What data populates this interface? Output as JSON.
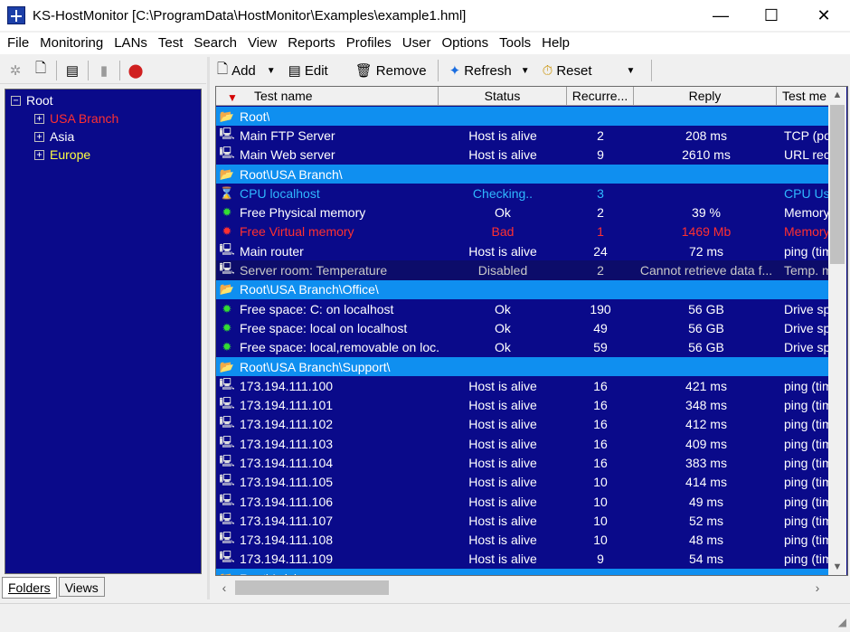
{
  "window": {
    "title": "KS-HostMonitor  [C:\\ProgramData\\HostMonitor\\Examples\\example1.hml]",
    "minimize": "—",
    "maximize": "☐",
    "close": "✕"
  },
  "menu": [
    "File",
    "Monitoring",
    "LANs",
    "Test",
    "Search",
    "View",
    "Reports",
    "Profiles",
    "User",
    "Options",
    "Tools",
    "Help"
  ],
  "tree": {
    "root": "Root",
    "children": [
      {
        "label": "USA Branch",
        "color": "#ff3030"
      },
      {
        "label": "Asia",
        "color": "#ffffff"
      },
      {
        "label": "Europe",
        "color": "#ffff40"
      }
    ]
  },
  "bottom_tabs": [
    "Folders",
    "Views"
  ],
  "toolbar": {
    "add": "Add",
    "edit": "Edit",
    "remove": "Remove",
    "refresh": "Refresh",
    "reset": "Reset"
  },
  "columns": [
    "Test name",
    "Status",
    "Recurre...",
    "Reply",
    "Test me"
  ],
  "rows": [
    {
      "type": "folder",
      "name": "Root\\"
    },
    {
      "type": "host",
      "name": "Main FTP Server",
      "status": "Host is alive",
      "rec": "2",
      "reply": "208 ms",
      "method": "TCP (po"
    },
    {
      "type": "host",
      "name": "Main Web server",
      "status": "Host is alive",
      "rec": "9",
      "reply": "2610 ms",
      "method": "URL rec"
    },
    {
      "type": "folder",
      "name": "Root\\USA Branch\\"
    },
    {
      "type": "checking",
      "name": "CPU localhost",
      "status": "Checking..",
      "rec": "3",
      "reply": "",
      "method": "CPU Us"
    },
    {
      "type": "ok",
      "name": "Free Physical memory",
      "status": "Ok",
      "rec": "2",
      "reply": "39 %",
      "method": "Memory"
    },
    {
      "type": "bad",
      "name": "Free Virtual memory",
      "status": "Bad",
      "rec": "1",
      "reply": "1469 Mb",
      "method": "Memory"
    },
    {
      "type": "host",
      "name": "Main router",
      "status": "Host is alive",
      "rec": "24",
      "reply": "72 ms",
      "method": "ping (tim"
    },
    {
      "type": "disabled",
      "name": "Server room: Temperature",
      "status": "Disabled",
      "rec": "2",
      "reply": "Cannot retrieve data f...",
      "method": "Temp. m"
    },
    {
      "type": "folder",
      "name": "Root\\USA Branch\\Office\\"
    },
    {
      "type": "ok",
      "name": "Free space: C: on localhost",
      "status": "Ok",
      "rec": "190",
      "reply": "56 GB",
      "method": "Drive sp"
    },
    {
      "type": "ok",
      "name": "Free space: local on localhost",
      "status": "Ok",
      "rec": "49",
      "reply": "56 GB",
      "method": "Drive sp"
    },
    {
      "type": "ok",
      "name": "Free space: local,removable on loc...",
      "status": "Ok",
      "rec": "59",
      "reply": "56 GB",
      "method": "Drive sp"
    },
    {
      "type": "folder",
      "name": "Root\\USA Branch\\Support\\"
    },
    {
      "type": "host",
      "name": "173.194.111.100",
      "status": "Host is alive",
      "rec": "16",
      "reply": "421 ms",
      "method": "ping (tim"
    },
    {
      "type": "host",
      "name": "173.194.111.101",
      "status": "Host is alive",
      "rec": "16",
      "reply": "348 ms",
      "method": "ping (tim"
    },
    {
      "type": "host",
      "name": "173.194.111.102",
      "status": "Host is alive",
      "rec": "16",
      "reply": "412 ms",
      "method": "ping (tim"
    },
    {
      "type": "host",
      "name": "173.194.111.103",
      "status": "Host is alive",
      "rec": "16",
      "reply": "409 ms",
      "method": "ping (tim"
    },
    {
      "type": "host",
      "name": "173.194.111.104",
      "status": "Host is alive",
      "rec": "16",
      "reply": "383 ms",
      "method": "ping (tim"
    },
    {
      "type": "host",
      "name": "173.194.111.105",
      "status": "Host is alive",
      "rec": "10",
      "reply": "414 ms",
      "method": "ping (tim"
    },
    {
      "type": "host",
      "name": "173.194.111.106",
      "status": "Host is alive",
      "rec": "10",
      "reply": "49 ms",
      "method": "ping (tim"
    },
    {
      "type": "host",
      "name": "173.194.111.107",
      "status": "Host is alive",
      "rec": "10",
      "reply": "52 ms",
      "method": "ping (tim"
    },
    {
      "type": "host",
      "name": "173.194.111.108",
      "status": "Host is alive",
      "rec": "10",
      "reply": "48 ms",
      "method": "ping (tim"
    },
    {
      "type": "host",
      "name": "173.194.111.109",
      "status": "Host is alive",
      "rec": "9",
      "reply": "54 ms",
      "method": "ping (tim"
    },
    {
      "type": "folder",
      "name": "Root\\Asia\\"
    }
  ],
  "icons": {
    "folder": "📂",
    "host": "🖳",
    "ok": "✹",
    "bad": "✹",
    "checking": "⌛",
    "disabled": "🖳"
  },
  "colors": {
    "grid_bg": "#0a0a8a",
    "folder_row": "#0f8ff0",
    "bad_text": "#ff3030",
    "ok_icon": "#33dd33",
    "checking_text": "#2fb8ff"
  }
}
